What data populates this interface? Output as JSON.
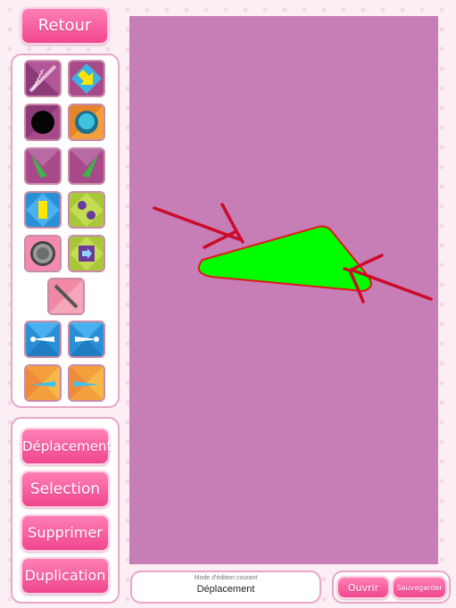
{
  "toolbar": {
    "back_label": "Retour"
  },
  "modes": {
    "move_label": "Déplacement",
    "select_label": "Selection",
    "delete_label": "Supprimer",
    "duplicate_label": "Duplication"
  },
  "status": {
    "caption": "Mode d'édition courant",
    "value": "Déplacement"
  },
  "file": {
    "open_label": "Ouvrir",
    "save_label": "Sauvegarder"
  },
  "tools": [
    {
      "icon": "spring-icon"
    },
    {
      "icon": "arrow-icon"
    },
    {
      "icon": "black-ball-icon"
    },
    {
      "icon": "blue-ball-icon"
    },
    {
      "icon": "left-flipper-icon"
    },
    {
      "icon": "right-flipper-icon"
    },
    {
      "icon": "yellow-block-icon"
    },
    {
      "icon": "bumper-pair-icon"
    },
    {
      "icon": "gray-bumper-icon"
    },
    {
      "icon": "portal-icon"
    },
    {
      "icon": "wall-icon"
    },
    {
      "icon": "left-paddle-icon"
    },
    {
      "icon": "right-paddle-icon"
    },
    {
      "icon": "left-ramp-icon"
    },
    {
      "icon": "right-ramp-icon"
    }
  ],
  "colors": {
    "accent": "#f0468f",
    "canvas": "#c77db5",
    "shape_fill": "#00ff00",
    "shape_stroke": "#e01818",
    "annotation": "#cc0a2a"
  }
}
